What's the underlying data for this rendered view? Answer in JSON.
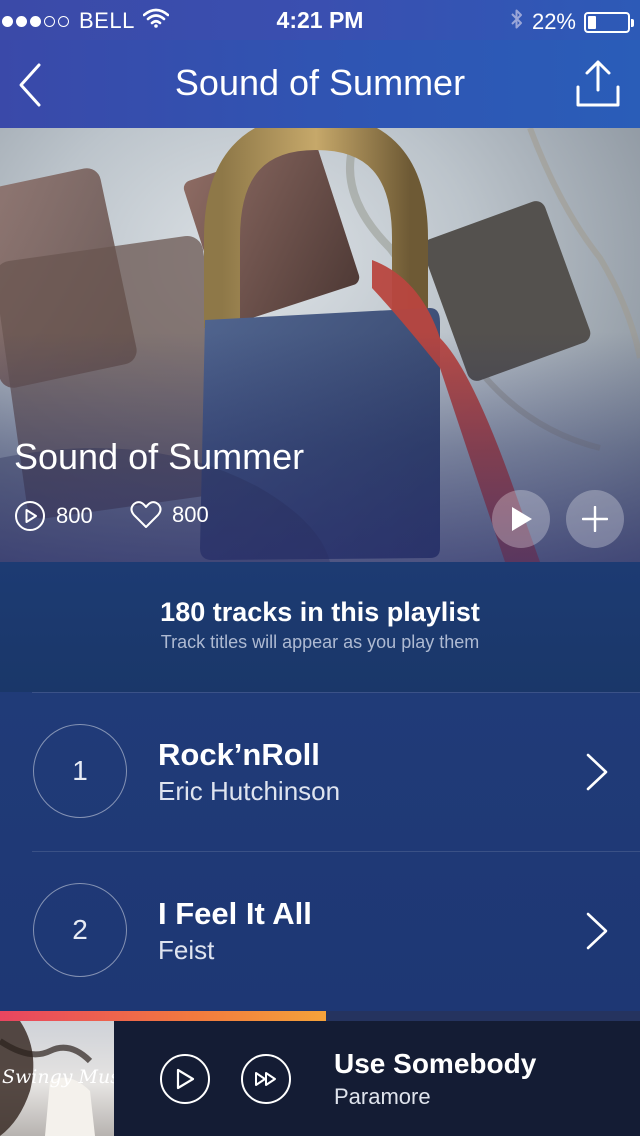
{
  "status_bar": {
    "carrier": "BELL",
    "time": "4:21 PM",
    "battery_percent": "22%",
    "signal_bars_filled": 3,
    "signal_bars_total": 5,
    "battery_level": 0.22
  },
  "nav": {
    "title": "Sound of Summer",
    "back_icon": "chevron-left-icon",
    "share_icon": "share-icon"
  },
  "hero": {
    "title": "Sound of Summer",
    "plays": "800",
    "likes": "800",
    "play_icon": "play-icon",
    "add_icon": "plus-icon"
  },
  "playlist_info": {
    "title": "180 tracks in this playlist",
    "subtitle": "Track titles will appear as you play them"
  },
  "tracks": [
    {
      "number": "1",
      "title": "Rock’nRoll",
      "artist": "Eric Hutchinson"
    },
    {
      "number": "2",
      "title": "I Feel It All",
      "artist": "Feist"
    }
  ],
  "now_playing": {
    "progress": 0.51,
    "album_art_text": "Swingy Music",
    "title": "Use Somebody",
    "artist": "Paramore"
  },
  "colors": {
    "header_gradient_start": "#3a49a9",
    "header_gradient_end": "#2a5db8",
    "progress_start": "#e84560",
    "progress_end": "#f5a23a",
    "player_bg": "#141c34"
  }
}
